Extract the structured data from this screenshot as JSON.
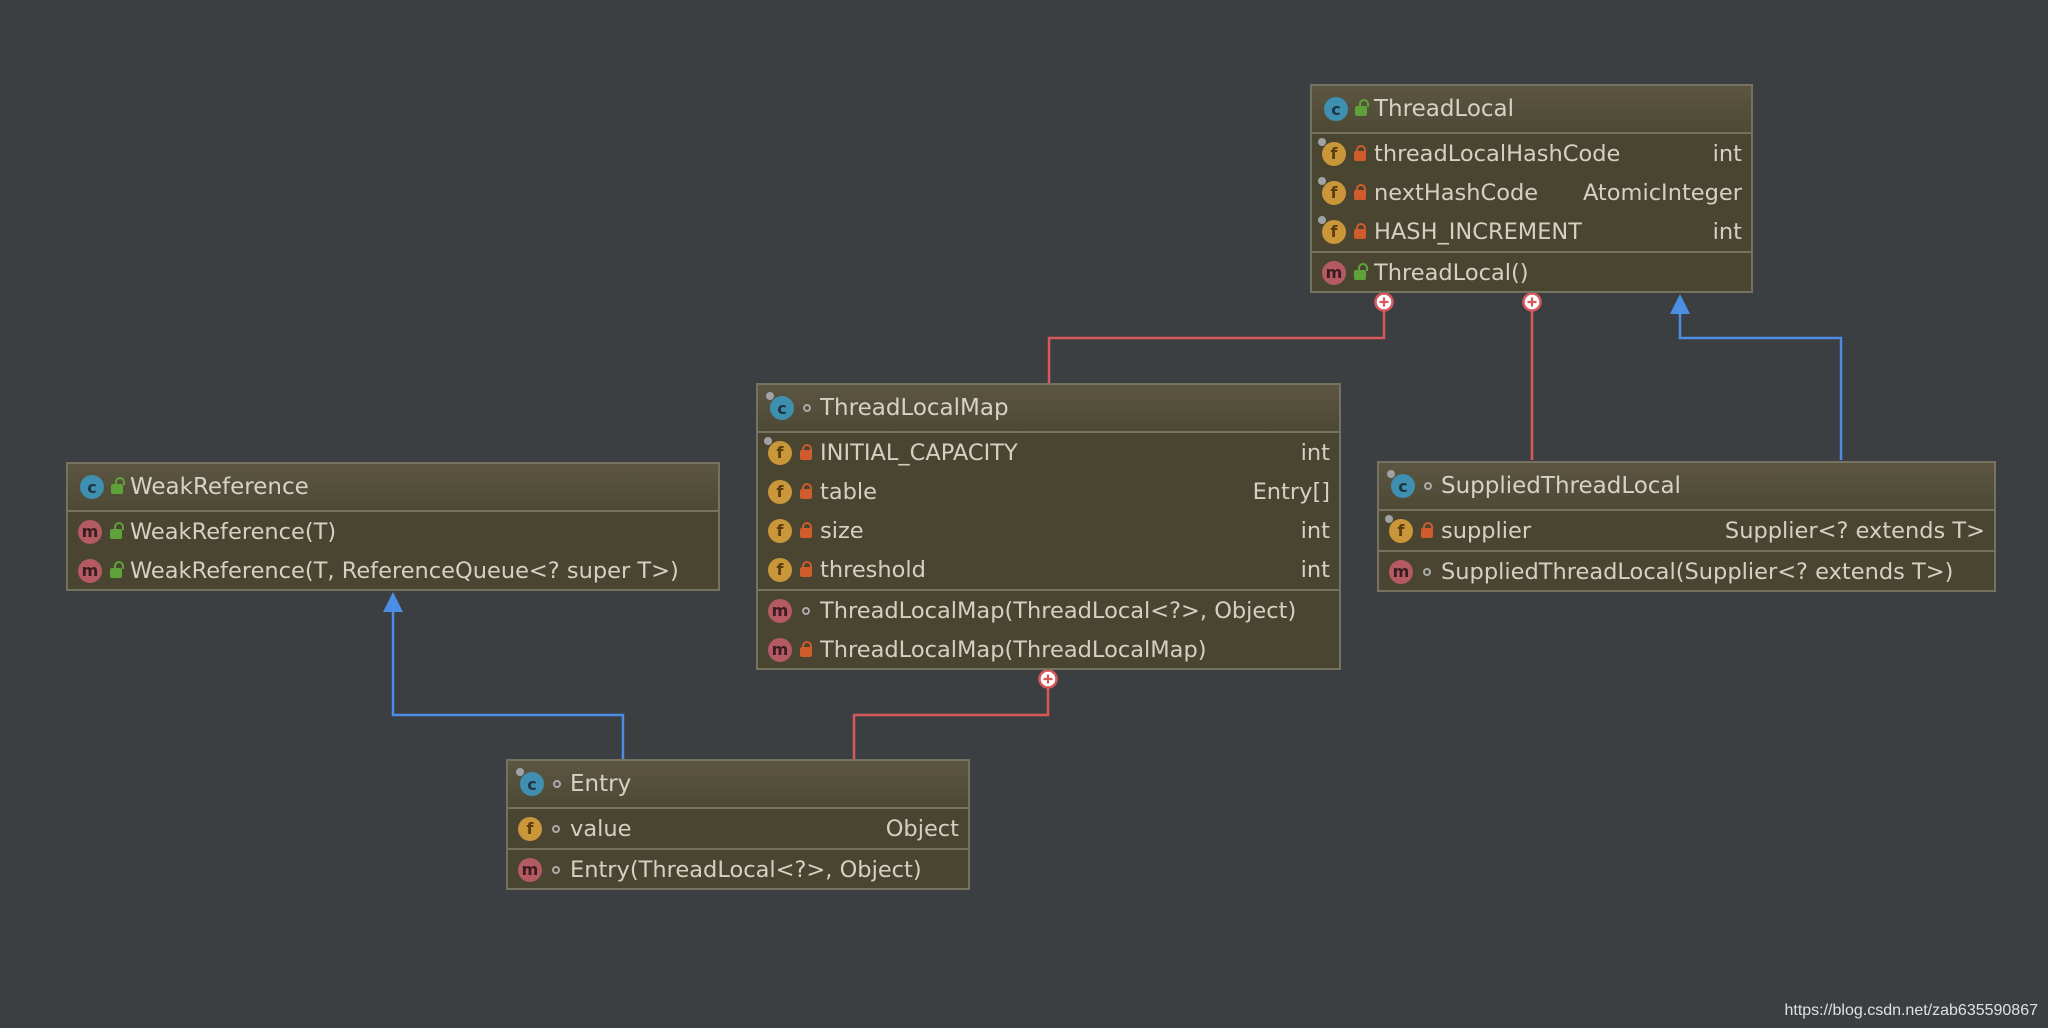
{
  "classes": {
    "threadlocal": {
      "name": "ThreadLocal",
      "fields": [
        {
          "name": "threadLocalHashCode",
          "type": "int"
        },
        {
          "name": "nextHashCode",
          "type": "AtomicInteger"
        },
        {
          "name": "HASH_INCREMENT",
          "type": "int"
        }
      ],
      "methods": [
        {
          "name": "ThreadLocal()"
        }
      ]
    },
    "threadlocalmap": {
      "name": "ThreadLocalMap",
      "fields": [
        {
          "name": "INITIAL_CAPACITY",
          "type": "int"
        },
        {
          "name": "table",
          "type": "Entry[]"
        },
        {
          "name": "size",
          "type": "int"
        },
        {
          "name": "threshold",
          "type": "int"
        }
      ],
      "methods": [
        {
          "name": "ThreadLocalMap(ThreadLocal<?>, Object)"
        },
        {
          "name": "ThreadLocalMap(ThreadLocalMap)"
        }
      ]
    },
    "weakreference": {
      "name": "WeakReference",
      "methods": [
        {
          "name": "WeakReference(T)"
        },
        {
          "name": "WeakReference(T, ReferenceQueue<? super T>)"
        }
      ]
    },
    "suppliedthreadlocal": {
      "name": "SuppliedThreadLocal",
      "fields": [
        {
          "name": "supplier",
          "type": "Supplier<? extends T>"
        }
      ],
      "methods": [
        {
          "name": "SuppliedThreadLocal(Supplier<? extends T>)"
        }
      ]
    },
    "entry": {
      "name": "Entry",
      "fields": [
        {
          "name": "value",
          "type": "Object"
        }
      ],
      "methods": [
        {
          "name": "Entry(ThreadLocal<?>, Object)"
        }
      ]
    }
  },
  "relations": [
    {
      "from": "ThreadLocalMap",
      "to": "ThreadLocal",
      "kind": "inner-class"
    },
    {
      "from": "SuppliedThreadLocal",
      "to": "ThreadLocal",
      "kind": "inner-class"
    },
    {
      "from": "SuppliedThreadLocal",
      "to": "ThreadLocal",
      "kind": "extends"
    },
    {
      "from": "Entry",
      "to": "ThreadLocalMap",
      "kind": "inner-class"
    },
    {
      "from": "Entry",
      "to": "WeakReference",
      "kind": "extends"
    }
  ],
  "colors": {
    "background": "#3c3f41",
    "inner_class_line": "#d9585c",
    "inheritance_line": "#4c8de6"
  },
  "icons": {
    "class": "class-icon",
    "field": "field-icon",
    "method": "method-icon",
    "private": "lock-icon",
    "public": "unlock-icon",
    "package": "circle-icon"
  },
  "watermark": "https://blog.csdn.net/zab635590867"
}
